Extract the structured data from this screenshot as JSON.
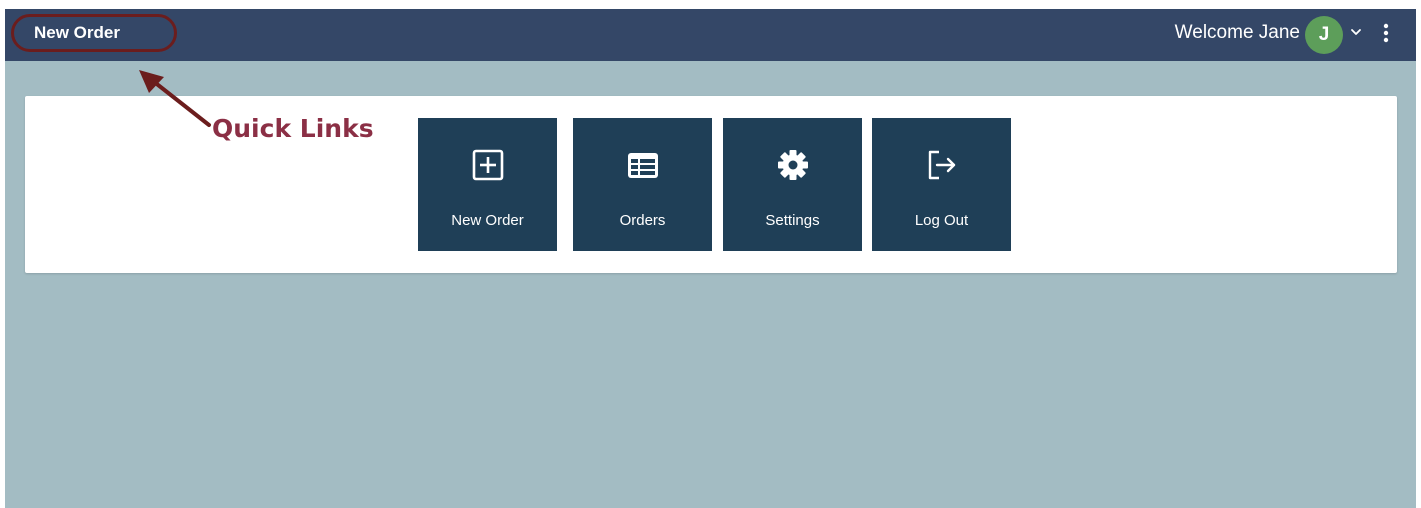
{
  "topbar": {
    "quick_link_label": "New Order",
    "welcome_text": "Welcome Jane",
    "avatar_initial": "J",
    "colors": {
      "bar": "#344767",
      "avatar": "#5d9e5a"
    }
  },
  "annotation": {
    "label": "Quick Links",
    "color": "#8b2f45"
  },
  "tiles": [
    {
      "label": "New Order",
      "icon": "plus-square-icon"
    },
    {
      "label": "Orders",
      "icon": "table-icon"
    },
    {
      "label": "Settings",
      "icon": "gear-icon"
    },
    {
      "label": "Log Out",
      "icon": "logout-icon"
    }
  ],
  "colors": {
    "background": "#a3bcc3",
    "tile": "#1f3f57",
    "panel": "#ffffff"
  }
}
